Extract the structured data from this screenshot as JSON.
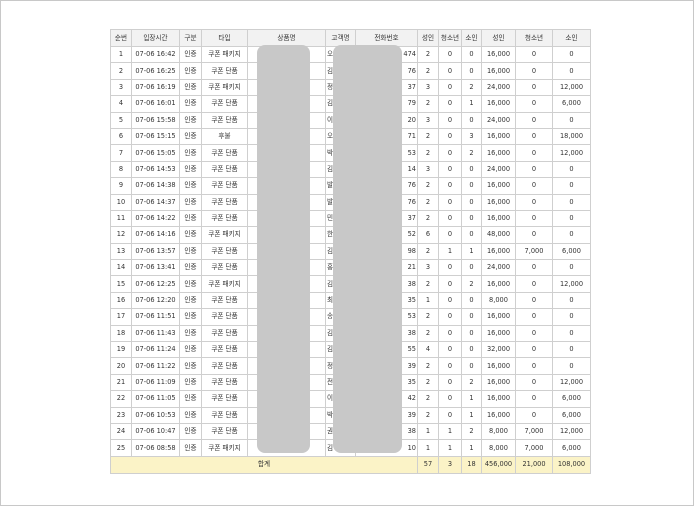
{
  "table": {
    "headers": [
      "순번",
      "입장시간",
      "구분",
      "타입",
      "상품명",
      "고객명",
      "전화번호",
      "성인",
      "청소년",
      "소인",
      "성인",
      "청소년",
      "소인"
    ],
    "rows": [
      {
        "no": "1",
        "time": "07-06 16:42",
        "cat": "인증",
        "type": "쿠폰 패키지",
        "name_vis": "오",
        "phone_vis": "474",
        "a": "2",
        "t": "0",
        "c": "0",
        "ap": "16,000",
        "tp": "0",
        "cp": "0"
      },
      {
        "no": "2",
        "time": "07-06 16:25",
        "cat": "인증",
        "type": "쿠폰 단품",
        "name_vis": "김",
        "phone_vis": "76",
        "a": "2",
        "t": "0",
        "c": "0",
        "ap": "16,000",
        "tp": "0",
        "cp": "0"
      },
      {
        "no": "3",
        "time": "07-06 16:19",
        "cat": "인증",
        "type": "쿠폰 패키지",
        "name_vis": "정",
        "phone_vis": "37",
        "a": "3",
        "t": "0",
        "c": "2",
        "ap": "24,000",
        "tp": "0",
        "cp": "12,000"
      },
      {
        "no": "4",
        "time": "07-06 16:01",
        "cat": "인증",
        "type": "쿠폰 단품",
        "name_vis": "김",
        "phone_vis": "79",
        "a": "2",
        "t": "0",
        "c": "1",
        "ap": "16,000",
        "tp": "0",
        "cp": "6,000"
      },
      {
        "no": "5",
        "time": "07-06 15:58",
        "cat": "인증",
        "type": "쿠폰 단품",
        "name_vis": "이",
        "phone_vis": "20",
        "a": "3",
        "t": "0",
        "c": "0",
        "ap": "24,000",
        "tp": "0",
        "cp": "0"
      },
      {
        "no": "6",
        "time": "07-06 15:15",
        "cat": "인증",
        "type": "후불",
        "name_vis": "오",
        "phone_vis": "71",
        "a": "2",
        "t": "0",
        "c": "3",
        "ap": "16,000",
        "tp": "0",
        "cp": "18,000"
      },
      {
        "no": "7",
        "time": "07-06 15:05",
        "cat": "인증",
        "type": "쿠폰 단품",
        "name_vis": "박",
        "phone_vis": "53",
        "a": "2",
        "t": "0",
        "c": "2",
        "ap": "16,000",
        "tp": "0",
        "cp": "12,000"
      },
      {
        "no": "8",
        "time": "07-06 14:53",
        "cat": "인증",
        "type": "쿠폰 단품",
        "name_vis": "김",
        "phone_vis": "14",
        "a": "3",
        "t": "0",
        "c": "0",
        "ap": "24,000",
        "tp": "0",
        "cp": "0"
      },
      {
        "no": "9",
        "time": "07-06 14:38",
        "cat": "인증",
        "type": "쿠폰 단품",
        "name_vis": "발",
        "phone_vis": "76",
        "a": "2",
        "t": "0",
        "c": "0",
        "ap": "16,000",
        "tp": "0",
        "cp": "0"
      },
      {
        "no": "10",
        "time": "07-06 14:37",
        "cat": "인증",
        "type": "쿠폰 단품",
        "name_vis": "발",
        "phone_vis": "76",
        "a": "2",
        "t": "0",
        "c": "0",
        "ap": "16,000",
        "tp": "0",
        "cp": "0"
      },
      {
        "no": "11",
        "time": "07-06 14:22",
        "cat": "인증",
        "type": "쿠폰 단품",
        "name_vis": "민",
        "phone_vis": "37",
        "a": "2",
        "t": "0",
        "c": "0",
        "ap": "16,000",
        "tp": "0",
        "cp": "0"
      },
      {
        "no": "12",
        "time": "07-06 14:16",
        "cat": "인증",
        "type": "쿠폰 패키지",
        "name_vis": "한",
        "phone_vis": "52",
        "a": "6",
        "t": "0",
        "c": "0",
        "ap": "48,000",
        "tp": "0",
        "cp": "0"
      },
      {
        "no": "13",
        "time": "07-06 13:57",
        "cat": "인증",
        "type": "쿠폰 단품",
        "name_vis": "김",
        "phone_vis": "98",
        "a": "2",
        "t": "1",
        "c": "1",
        "ap": "16,000",
        "tp": "7,000",
        "cp": "6,000"
      },
      {
        "no": "14",
        "time": "07-06 13:41",
        "cat": "인증",
        "type": "쿠폰 단품",
        "name_vis": "홍",
        "phone_vis": "21",
        "a": "3",
        "t": "0",
        "c": "0",
        "ap": "24,000",
        "tp": "0",
        "cp": "0"
      },
      {
        "no": "15",
        "time": "07-06 12:25",
        "cat": "인증",
        "type": "쿠폰 패키지",
        "name_vis": "김",
        "phone_vis": "38",
        "a": "2",
        "t": "0",
        "c": "2",
        "ap": "16,000",
        "tp": "0",
        "cp": "12,000"
      },
      {
        "no": "16",
        "time": "07-06 12:20",
        "cat": "인증",
        "type": "쿠폰 단품",
        "name_vis": "최",
        "phone_vis": "35",
        "a": "1",
        "t": "0",
        "c": "0",
        "ap": "8,000",
        "tp": "0",
        "cp": "0"
      },
      {
        "no": "17",
        "time": "07-06 11:51",
        "cat": "인증",
        "type": "쿠폰 단품",
        "name_vis": "송",
        "phone_vis": "53",
        "a": "2",
        "t": "0",
        "c": "0",
        "ap": "16,000",
        "tp": "0",
        "cp": "0"
      },
      {
        "no": "18",
        "time": "07-06 11:43",
        "cat": "인증",
        "type": "쿠폰 단품",
        "name_vis": "김",
        "phone_vis": "38",
        "a": "2",
        "t": "0",
        "c": "0",
        "ap": "16,000",
        "tp": "0",
        "cp": "0"
      },
      {
        "no": "19",
        "time": "07-06 11:24",
        "cat": "인증",
        "type": "쿠폰 단품",
        "name_vis": "김",
        "phone_vis": "55",
        "a": "4",
        "t": "0",
        "c": "0",
        "ap": "32,000",
        "tp": "0",
        "cp": "0"
      },
      {
        "no": "20",
        "time": "07-06 11:22",
        "cat": "인증",
        "type": "쿠폰 단품",
        "name_vis": "정",
        "phone_vis": "39",
        "a": "2",
        "t": "0",
        "c": "0",
        "ap": "16,000",
        "tp": "0",
        "cp": "0"
      },
      {
        "no": "21",
        "time": "07-06 11:09",
        "cat": "인증",
        "type": "쿠폰 단품",
        "name_vis": "전",
        "phone_vis": "35",
        "a": "2",
        "t": "0",
        "c": "2",
        "ap": "16,000",
        "tp": "0",
        "cp": "12,000"
      },
      {
        "no": "22",
        "time": "07-06 11:05",
        "cat": "인증",
        "type": "쿠폰 단품",
        "name_vis": "이",
        "phone_vis": "42",
        "a": "2",
        "t": "0",
        "c": "1",
        "ap": "16,000",
        "tp": "0",
        "cp": "6,000"
      },
      {
        "no": "23",
        "time": "07-06 10:53",
        "cat": "인증",
        "type": "쿠폰 단품",
        "name_vis": "박",
        "phone_vis": "39",
        "a": "2",
        "t": "0",
        "c": "1",
        "ap": "16,000",
        "tp": "0",
        "cp": "6,000"
      },
      {
        "no": "24",
        "time": "07-06 10:47",
        "cat": "인증",
        "type": "쿠폰 단품",
        "name_vis": "권",
        "phone_vis": "38",
        "a": "1",
        "t": "1",
        "c": "2",
        "ap": "8,000",
        "tp": "7,000",
        "cp": "12,000"
      },
      {
        "no": "25",
        "time": "07-06 08:58",
        "cat": "인증",
        "type": "쿠폰 패키지",
        "name_vis": "김",
        "phone_vis": "10",
        "a": "1",
        "t": "1",
        "c": "1",
        "ap": "8,000",
        "tp": "7,000",
        "cp": "6,000"
      }
    ],
    "footer": {
      "label": "합계",
      "a": "57",
      "t": "3",
      "c": "18",
      "ap": "456,000",
      "tp": "21,000",
      "cp": "108,000"
    }
  },
  "colors": {
    "header_bg": "#f2f2f2",
    "footer_bg": "#fbf3c7",
    "border": "#cfcfcf",
    "redaction": "#c8c8c8"
  }
}
